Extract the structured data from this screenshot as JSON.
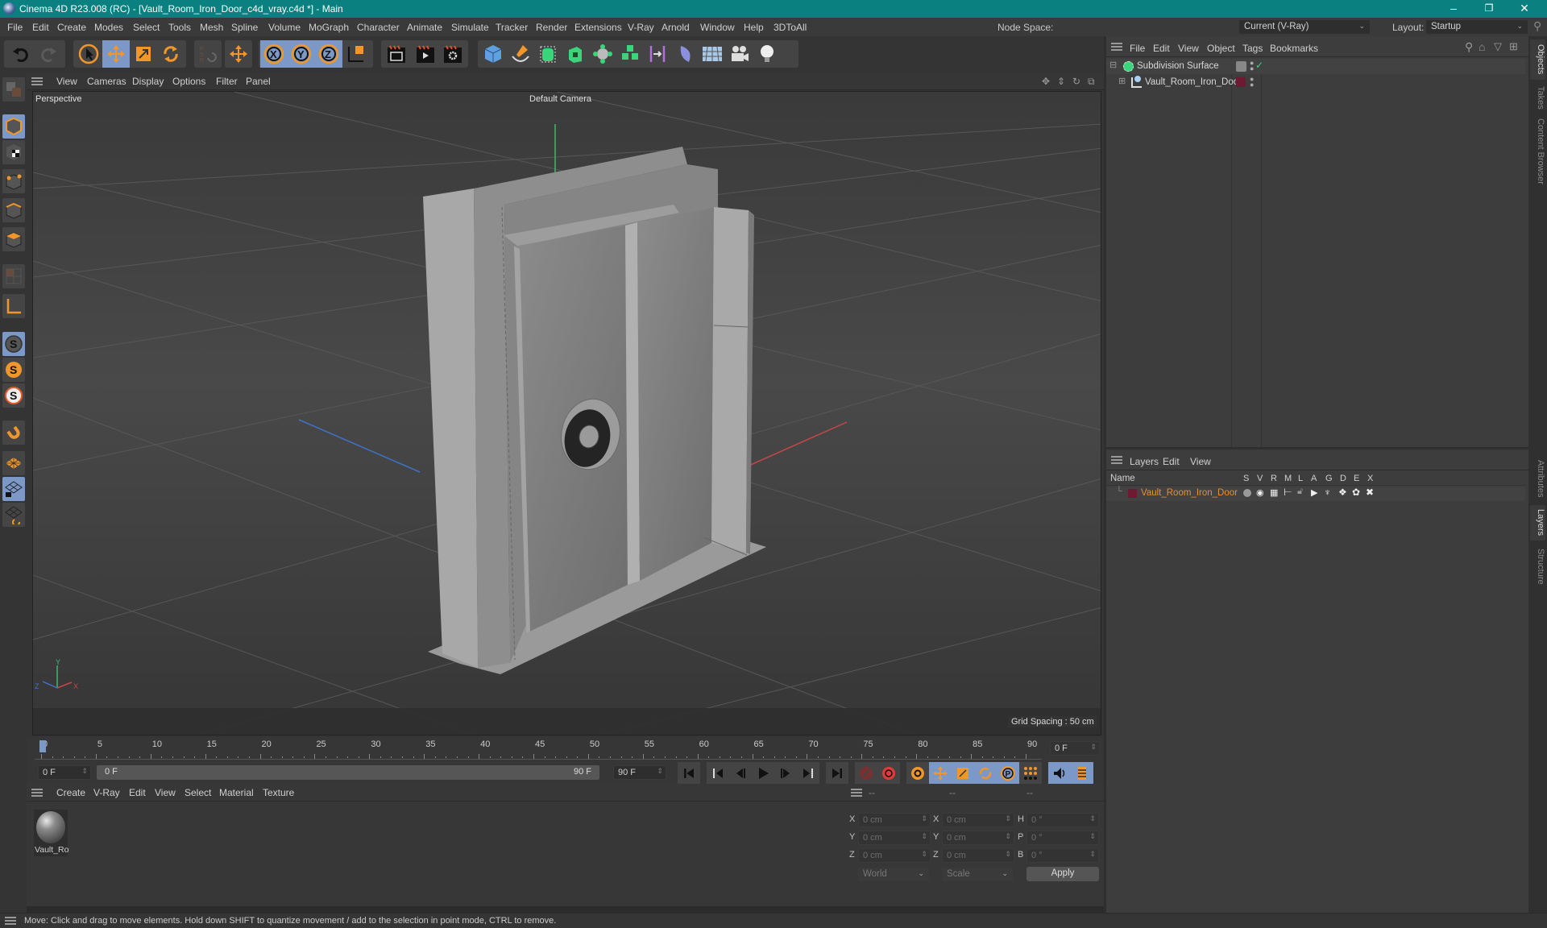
{
  "window": {
    "title": "Cinema 4D R23.008 (RC) - [Vault_Room_Iron_Door_c4d_vray.c4d *] - Main",
    "minimize": "–",
    "maximize": "❐",
    "close": "✕"
  },
  "menubar": {
    "items": [
      "File",
      "Edit",
      "Create",
      "Modes",
      "Select",
      "Tools",
      "Mesh",
      "Spline",
      "Volume",
      "MoGraph",
      "Character",
      "Animate",
      "Simulate",
      "Tracker",
      "Render",
      "Extensions",
      "V-Ray",
      "Arnold",
      "Window",
      "Help",
      "3DToAll"
    ],
    "node_space_label": "Node Space:",
    "node_space_value": "Current (V-Ray)",
    "layout_label": "Layout:",
    "layout_value": "Startup"
  },
  "toolbar": {
    "groups": [
      {
        "name": "history",
        "buttons": [
          "undo",
          "redo"
        ]
      },
      {
        "name": "tools",
        "buttons": [
          "live-selection",
          "move",
          "scale",
          "rotate"
        ]
      },
      {
        "name": "psr",
        "buttons": [
          "psr-reset"
        ]
      },
      {
        "name": "move-alt",
        "buttons": [
          "move-alt"
        ]
      },
      {
        "name": "axis",
        "buttons": [
          "x-axis",
          "y-axis",
          "z-axis",
          "coordinate-system"
        ]
      },
      {
        "name": "render",
        "buttons": [
          "render-region",
          "render-view",
          "render-settings"
        ]
      },
      {
        "name": "create",
        "buttons": [
          "cube",
          "pen",
          "subdivision",
          "extrude",
          "cloner",
          "array",
          "symmetry",
          "deformer",
          "floor",
          "camera",
          "light"
        ]
      }
    ]
  },
  "left_toolbar": {
    "buttons": [
      "make-editable",
      "model-mode",
      "texture-mode",
      "point-mode",
      "edge-mode",
      "polygon-mode",
      "uv-mode",
      "axis-mode",
      "snap-toggle",
      "snap-settings",
      "snap-workplane",
      "magnet",
      "workplane",
      "locked-workplane",
      "workplane-align"
    ]
  },
  "viewport": {
    "menu": [
      "View",
      "Cameras",
      "Display",
      "Options",
      "Filter",
      "Panel"
    ],
    "view_name": "Perspective",
    "camera_name": "Default Camera",
    "grid_spacing": "Grid Spacing : 50 cm",
    "axis_labels": {
      "x": "X",
      "y": "Y",
      "z": "Z"
    },
    "colors": {
      "x_axis": "#c84646",
      "y_axis": "#3fb86a",
      "z_axis": "#3f73c8"
    }
  },
  "timeline": {
    "ticks": [
      "0",
      "5",
      "10",
      "15",
      "20",
      "25",
      "30",
      "35",
      "40",
      "45",
      "50",
      "55",
      "60",
      "65",
      "70",
      "75",
      "80",
      "85",
      "90"
    ],
    "current_frame_display": "0 F",
    "start_frame": "0 F",
    "range_start": "0 F",
    "range_end": "90 F",
    "end_frame": "90 F",
    "playhead_frame": 0,
    "max_frame": 90
  },
  "material_panel": {
    "menu": [
      "Create",
      "V-Ray",
      "Edit",
      "View",
      "Select",
      "Material",
      "Texture"
    ],
    "materials": [
      {
        "name": "Vault_Ro"
      }
    ]
  },
  "coordinates": {
    "headers": [
      "--",
      "--",
      "--"
    ],
    "rows": [
      {
        "pos_label": "X",
        "pos": "0 cm",
        "size_label": "X",
        "size": "0 cm",
        "rot_label": "H",
        "rot": "0 °"
      },
      {
        "pos_label": "Y",
        "pos": "0 cm",
        "size_label": "Y",
        "size": "0 cm",
        "rot_label": "P",
        "rot": "0 °"
      },
      {
        "pos_label": "Z",
        "pos": "0 cm",
        "size_label": "Z",
        "size": "0 cm",
        "rot_label": "B",
        "rot": "0 °"
      }
    ],
    "mode": "World",
    "transform": "Scale",
    "apply_label": "Apply"
  },
  "object_manager": {
    "menu": [
      "File",
      "Edit",
      "View",
      "Object",
      "Tags",
      "Bookmarks"
    ],
    "objects": [
      {
        "name": "Subdivision Surface",
        "level": 0,
        "expand": "⊟"
      },
      {
        "name": "Vault_Room_Iron_Door",
        "level": 1,
        "expand": "⊞",
        "layer_color": "#6e1a33"
      }
    ]
  },
  "layer_manager": {
    "menu": [
      "Layers",
      "Edit",
      "View"
    ],
    "columns": [
      "Name",
      "S",
      "V",
      "R",
      "M",
      "L",
      "A",
      "G",
      "D",
      "E",
      "X"
    ],
    "layers": [
      {
        "name": "Vault_Room_Iron_Door",
        "color": "#6e1a33",
        "text_color": "#e8902e"
      }
    ]
  },
  "side_tabs": {
    "top": [
      "Objects",
      "Takes",
      "Content Browser"
    ],
    "bottom": [
      "Attributes",
      "Layers",
      "Structure"
    ]
  },
  "status": {
    "message": "Move: Click and drag to move elements. Hold down SHIFT to quantize movement / add to the selection in point mode, CTRL to remove."
  },
  "colors": {
    "title_bar": "#0a8080",
    "accent_orange": "#f0962a",
    "active_blue": "#7b98c7"
  }
}
